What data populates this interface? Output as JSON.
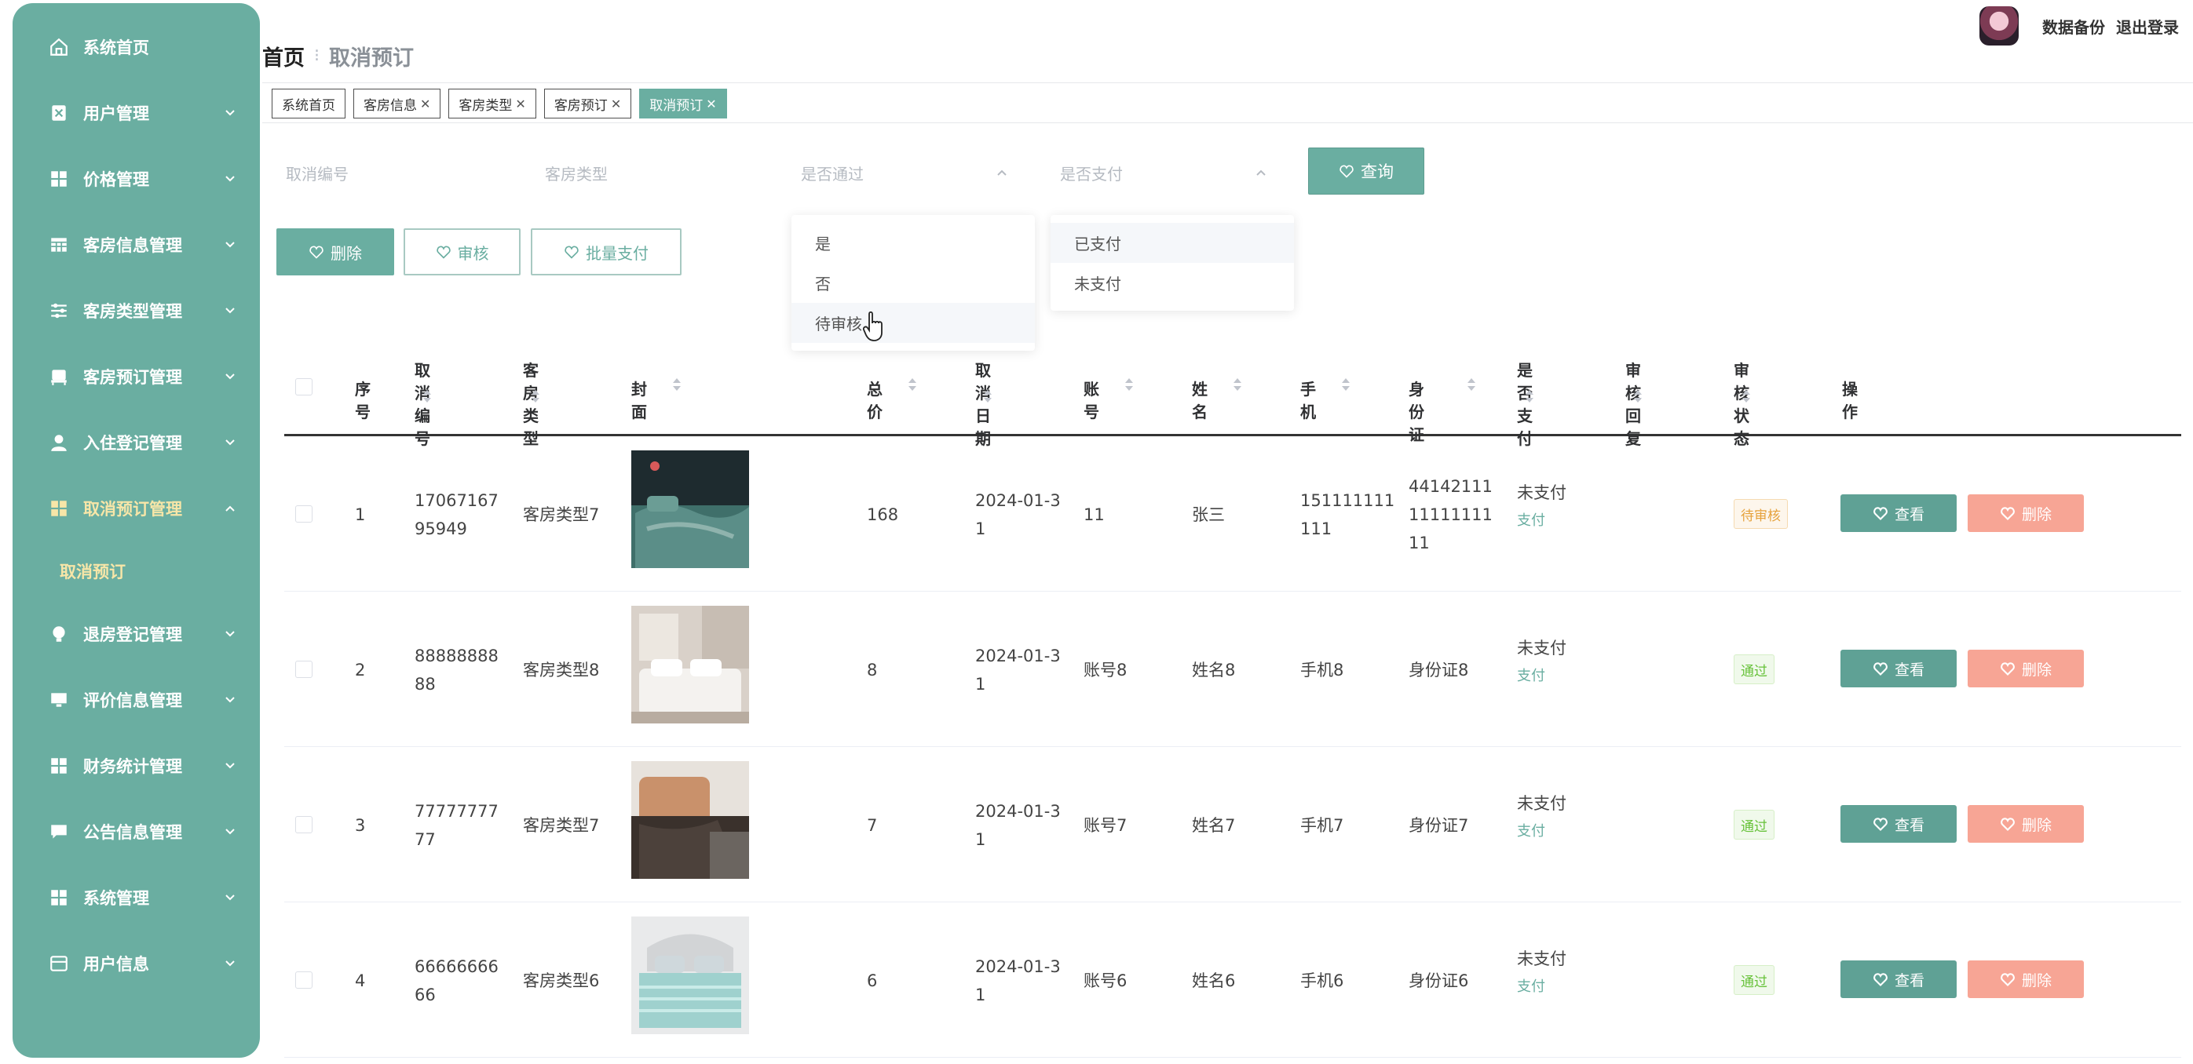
{
  "sidebar": {
    "items": [
      {
        "label": "系统首页",
        "icon": "home-icon"
      },
      {
        "label": "用户管理",
        "icon": "user-manage-icon"
      },
      {
        "label": "价格管理",
        "icon": "grid-icon"
      },
      {
        "label": "客房信息管理",
        "icon": "table-icon"
      },
      {
        "label": "客房类型管理",
        "icon": "sliders-icon"
      },
      {
        "label": "客房预订管理",
        "icon": "bed-icon"
      },
      {
        "label": "入住登记管理",
        "icon": "person-icon"
      },
      {
        "label": "取消预订管理",
        "icon": "grid-icon"
      },
      {
        "label": "退房登记管理",
        "icon": "bulb-icon"
      },
      {
        "label": "评价信息管理",
        "icon": "monitor-icon"
      },
      {
        "label": "财务统计管理",
        "icon": "grid-icon"
      },
      {
        "label": "公告信息管理",
        "icon": "chat-icon"
      },
      {
        "label": "系统管理",
        "icon": "grid-icon"
      },
      {
        "label": "用户信息",
        "icon": "card-icon"
      }
    ],
    "submenu_label": "取消预订"
  },
  "header": {
    "breadcrumb_home": "首页",
    "breadcrumb_current": "取消预订",
    "backup": "数据备份",
    "logout": "退出登录"
  },
  "tags": [
    {
      "label": "系统首页",
      "closable": false
    },
    {
      "label": "客房信息",
      "closable": true
    },
    {
      "label": "客房类型",
      "closable": true
    },
    {
      "label": "客房预订",
      "closable": true
    },
    {
      "label": "取消预订",
      "closable": true,
      "active": true
    }
  ],
  "filters": {
    "cancel_no": "取消编号",
    "room_type": "客房类型",
    "approved": "是否通过",
    "paid": "是否支付",
    "query_button": "查询"
  },
  "dropdown_approved": [
    "是",
    "否",
    "待审核"
  ],
  "dropdown_paid": [
    "已支付",
    "未支付"
  ],
  "actions": {
    "delete": "删除",
    "audit": "审核",
    "batch_pay": "批量支付"
  },
  "table": {
    "headers": {
      "index": "序号",
      "cancel_no": "取消编号",
      "room_type": "客房类型",
      "cover": "封面",
      "total": "总价",
      "cancel_date": "取消日期",
      "account": "账号",
      "name": "姓名",
      "phone": "手机",
      "id_card": "身份证",
      "paid": "是否支付",
      "reply": "审核回复",
      "status": "审核状态",
      "ops": "操作"
    },
    "rows": [
      {
        "index": "1",
        "cancel_no_1": "17067167",
        "cancel_no_2": "95949",
        "room_type": "客房类型7",
        "total": "168",
        "date_1": "2024-01-3",
        "date_2": "1",
        "account": "11",
        "name": "张三",
        "phone_1": "151111111",
        "phone_2": "111",
        "id_1": "44142111",
        "id_2": "11111111",
        "id_3": "11",
        "paid": "未支付",
        "pay_link": "支付",
        "status": "待审核",
        "view": "查看",
        "delete": "删除"
      },
      {
        "index": "2",
        "cancel_no_1": "88888888",
        "cancel_no_2": "88",
        "room_type": "客房类型8",
        "total": "8",
        "date_1": "2024-01-3",
        "date_2": "1",
        "account": "账号8",
        "name": "姓名8",
        "phone_1": "手机8",
        "phone_2": "",
        "id_1": "身份证8",
        "id_2": "",
        "id_3": "",
        "paid": "未支付",
        "pay_link": "支付",
        "status": "通过",
        "view": "查看",
        "delete": "删除"
      },
      {
        "index": "3",
        "cancel_no_1": "77777777",
        "cancel_no_2": "77",
        "room_type": "客房类型7",
        "total": "7",
        "date_1": "2024-01-3",
        "date_2": "1",
        "account": "账号7",
        "name": "姓名7",
        "phone_1": "手机7",
        "phone_2": "",
        "id_1": "身份证7",
        "id_2": "",
        "id_3": "",
        "paid": "未支付",
        "pay_link": "支付",
        "status": "通过",
        "view": "查看",
        "delete": "删除"
      },
      {
        "index": "4",
        "cancel_no_1": "66666666",
        "cancel_no_2": "66",
        "room_type": "客房类型6",
        "total": "6",
        "date_1": "2024-01-3",
        "date_2": "1",
        "account": "账号6",
        "name": "姓名6",
        "phone_1": "手机6",
        "phone_2": "",
        "id_1": "身份证6",
        "id_2": "",
        "id_3": "",
        "paid": "未支付",
        "pay_link": "支付",
        "status": "通过",
        "view": "查看",
        "delete": "删除"
      }
    ]
  },
  "colors": {
    "accent": "#6aaea1",
    "active_menu": "#f7e6a8",
    "danger": "#f7a595"
  }
}
